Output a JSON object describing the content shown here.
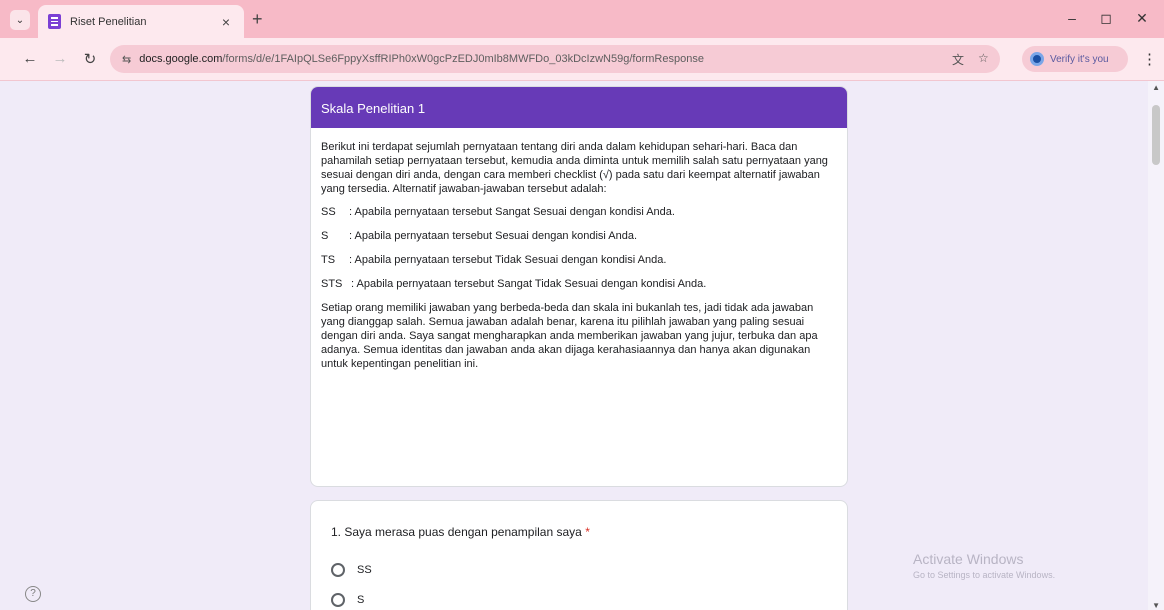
{
  "browser": {
    "tab": {
      "title": "Riset Penelitian",
      "close": "×"
    },
    "tab_search": "⌄",
    "new_tab": "+",
    "window": {
      "minimize": "–",
      "restore": "◻",
      "close": "✕"
    },
    "nav": {
      "back": "←",
      "forward": "→",
      "reload": "↻"
    },
    "site_info": "⇆",
    "url_host": "docs.google.com",
    "url_path": "/forms/d/e/1FAIpQLSe6FppyXsffRIPh0xW0gcPzEDJ0mIb8MWFDo_03kDcIzwN59g/formResponse",
    "translate_icon": "文",
    "bookmark_icon": "☆",
    "profile_label": "Verify it's you",
    "menu": "⋮"
  },
  "form": {
    "section_title": "Skala Penelitian 1",
    "intro": "Berikut ini terdapat sejumlah pernyataan tentang diri anda dalam kehidupan sehari-hari. Baca dan pahamilah setiap pernyataan tersebut, kemudia anda diminta untuk memilih salah satu pernyataan yang sesuai dengan diri anda, dengan cara memberi checklist (√) pada satu dari keempat alternatif jawaban yang tersedia. Alternatif jawaban-jawaban tersebut adalah:",
    "scale": [
      {
        "abbr": "SS",
        "desc": ": Apabila pernyataan tersebut Sangat Sesuai dengan kondisi Anda."
      },
      {
        "abbr": "S",
        "desc": ": Apabila pernyataan tersebut Sesuai dengan kondisi Anda."
      },
      {
        "abbr": "TS",
        "desc": ": Apabila pernyataan tersebut Tidak Sesuai dengan kondisi Anda."
      },
      {
        "abbr": "STS",
        "desc": ": Apabila pernyataan tersebut Sangat Tidak Sesuai dengan kondisi Anda."
      }
    ],
    "closing": "Setiap orang memiliki jawaban yang berbeda-beda dan skala ini bukanlah tes, jadi tidak ada jawaban yang dianggap salah. Semua jawaban adalah benar, karena itu pilihlah jawaban yang paling sesuai dengan diri anda. Saya sangat mengharapkan anda memberikan jawaban yang jujur, terbuka dan apa adanya. Semua identitas dan jawaban anda akan dijaga kerahasiaannya dan hanya akan digunakan untuk kepentingan penelitian ini.",
    "question1": {
      "title": "1. Saya merasa puas dengan penampilan saya",
      "required_mark": "*",
      "options": [
        "SS",
        "S"
      ]
    }
  },
  "page": {
    "help": "?",
    "watermark_title": "Activate Windows",
    "watermark_sub": "Go to Settings to activate Windows."
  },
  "colors": {
    "tabstrip": "#f7bac7",
    "form_accent": "#673ab7",
    "page_bg": "#f0ebf8"
  }
}
